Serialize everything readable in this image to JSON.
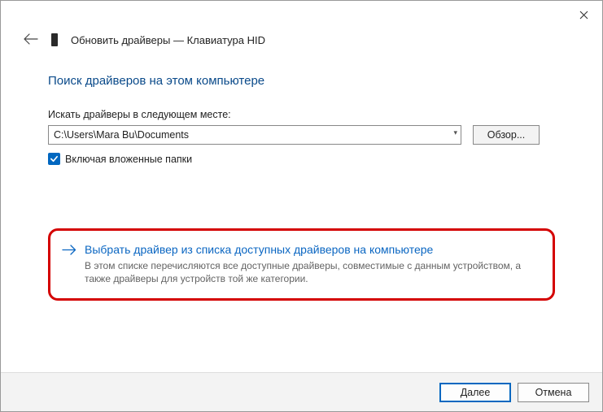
{
  "window": {
    "title": "Обновить драйверы — Клавиатура HID"
  },
  "main": {
    "heading": "Поиск драйверов на этом компьютере",
    "search_label": "Искать драйверы в следующем месте:",
    "path_value": "C:\\Users\\Mara Bu\\Documents",
    "browse_label": "Обзор...",
    "include_subfolders_label": "Включая вложенные папки"
  },
  "pick": {
    "title": "Выбрать драйвер из списка доступных драйверов на компьютере",
    "description": "В этом списке перечисляются все доступные драйверы, совместимые с данным устройством, а также драйверы для устройств той же категории."
  },
  "footer": {
    "next": "Далее",
    "cancel": "Отмена"
  }
}
